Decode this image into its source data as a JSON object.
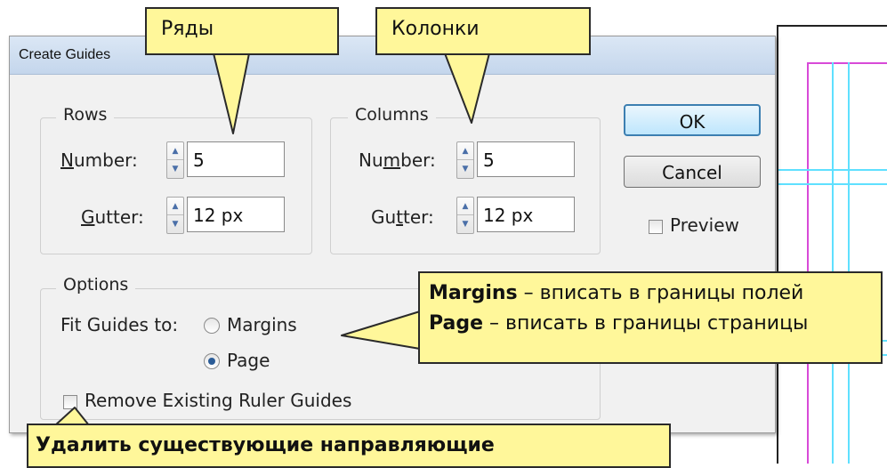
{
  "dialog": {
    "title": "Create Guides",
    "rows": {
      "legend": "Rows",
      "number_label_pre": "",
      "number_label_u": "N",
      "number_label_post": "umber:",
      "number_value": "5",
      "gutter_label_u": "G",
      "gutter_label_post": "utter:",
      "gutter_value": "12 px"
    },
    "columns": {
      "legend": "Columns",
      "number_label_pre": "Nu",
      "number_label_u": "m",
      "number_label_post": "ber:",
      "number_value": "5",
      "gutter_label_pre": "Gu",
      "gutter_label_u": "t",
      "gutter_label_post": "ter:",
      "gutter_value": "12 px"
    },
    "options": {
      "legend": "Options",
      "fit_label": "Fit Guides to:",
      "margins_label": "Margins",
      "page_label": "Page",
      "selected": "Page",
      "remove_label": "Remove Existing Ruler Guides"
    },
    "buttons": {
      "ok": "OK",
      "cancel": "Cancel"
    },
    "preview_label": "Preview"
  },
  "callouts": {
    "rows": "Ряды",
    "columns": "Колонки",
    "margins_bold": "Margins",
    "margins_text": " – вписать в границы полей",
    "page_bold": "Page",
    "page_text": " – вписать в границы страницы",
    "remove": "Удалить существующие направляющие"
  },
  "colors": {
    "callout_fill": "#fff79a",
    "guide_cyan": "#5fe0ff",
    "margin_magenta": "#d84ad8"
  }
}
